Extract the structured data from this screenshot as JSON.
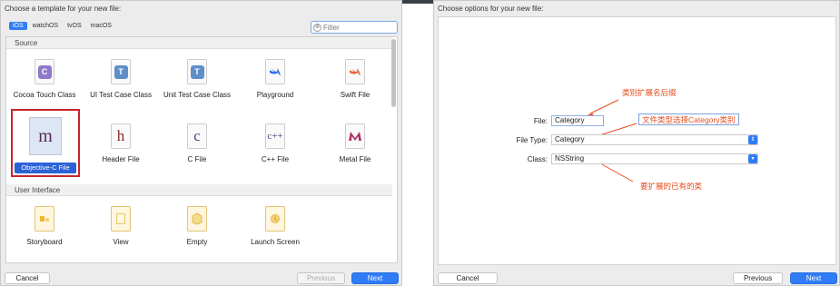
{
  "left_panel": {
    "title": "Choose a template for your new file:",
    "platform_tabs": [
      "iOS",
      "watchOS",
      "tvOS",
      "macOS"
    ],
    "filter_placeholder": "Filter",
    "sections": {
      "source": "Source",
      "user_interface": "User Interface"
    },
    "source_row1": [
      {
        "label": "Cocoa Touch Class",
        "glyph": "C",
        "color": "#8e79c8"
      },
      {
        "label": "UI Test Case Class",
        "glyph": "T",
        "color": "#5f8ec9"
      },
      {
        "label": "Unit Test Case Class",
        "glyph": "T",
        "color": "#5f8ec9"
      },
      {
        "label": "Playground",
        "glyph": "swift",
        "color": "#e8653c"
      },
      {
        "label": "Swift File",
        "glyph": "swift",
        "color": "#e8653c"
      }
    ],
    "selected_item": {
      "label": "Objective-C File",
      "glyph": "m"
    },
    "source_row2": [
      {
        "label": "Header File",
        "glyph": "h",
        "color": "#8a2a2a"
      },
      {
        "label": "C File",
        "glyph": "c",
        "color": "#4a4a8a"
      },
      {
        "label": "C++ File",
        "glyph": "C++",
        "color": "#5a3a7a"
      },
      {
        "label": "Metal File",
        "glyph": "M",
        "color": "#b0306a"
      }
    ],
    "ui_row": [
      {
        "label": "Storyboard"
      },
      {
        "label": "View"
      },
      {
        "label": "Empty"
      },
      {
        "label": "Launch Screen"
      }
    ],
    "buttons": {
      "cancel": "Cancel",
      "previous": "Previous",
      "next": "Next"
    }
  },
  "right_panel": {
    "title": "Choose options for your new file:",
    "fields": {
      "file_label": "File:",
      "file_value": "Category",
      "file_type_label": "File Type:",
      "file_type_value": "Category",
      "class_label": "Class:",
      "class_value": "NSString"
    },
    "annotations": {
      "file_note": "类别扩展名后缀",
      "type_note": "文件类型选择Category类别",
      "class_note": "要扩展的已有的类"
    },
    "buttons": {
      "cancel": "Cancel",
      "previous": "Previous",
      "next": "Next"
    }
  },
  "colors": {
    "accent": "#2f7cf6",
    "annotation": "#e74c1b",
    "highlight_box": "#c8262b"
  }
}
